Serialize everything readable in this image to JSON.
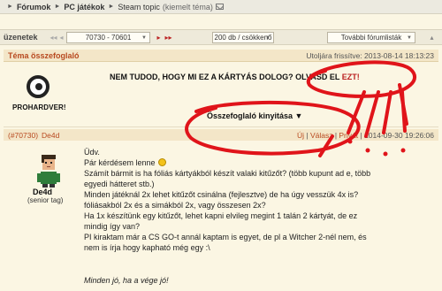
{
  "breadcrumb": {
    "items": [
      "Fórumok",
      "PC játékok",
      "Steam topic"
    ],
    "suffix": "(kiemelt téma)"
  },
  "navbar": {
    "label": "üzenetek",
    "range_select": "70730 - 70601",
    "count_select": "200 db / csökkenő",
    "more_select": "További fórumlisták"
  },
  "topic": {
    "title": "Téma összefoglaló",
    "updated": "Utoljára frissítve: 2013-08-14 18:13:23",
    "logo_text": "PROHARDVER!",
    "notice_text": "NEM TUDOD, HOGY MI EZ A KÁRTYÁS DOLOG? OLVASD EL",
    "notice_link": "EZT!",
    "expand_label": "Összefoglaló kinyitása ▼"
  },
  "post": {
    "number": "(#70730)",
    "user": "De4d",
    "actions": {
      "new": "Új",
      "reply": "Válasz",
      "private": "Privát",
      "timestamp": "2014-09-30 19:26:06"
    },
    "author_name": "De4d",
    "author_tag": "(senior tag)",
    "lines": [
      "Üdv.",
      "Pár kérdésem lenne",
      "Számít bármit is ha fóliás kártyákból készít valaki kitűzőt? (több kupunt ad e, több",
      "egyedi hátteret stb.)",
      "Minden játéknál 2x lehet kitűzőt csinálna (fejlesztve) de ha úgy vesszük 4x is?",
      "fóliásakból 2x és a simákból 2x, vagy összesen 2x?",
      "Ha 1x készítünk egy kitűzőt, lehet kapni elvileg megint 1 talán 2 kártyát, de ez",
      "mindig így van?",
      "PI kiraktam már a CS GO-t annál kaptam is egyet, de pl a Witcher 2-nél nem, és",
      "nem is írja hogy kapható még egy :\\"
    ],
    "signature": "Minden jó, ha a vége jó!"
  },
  "colors": {
    "accent": "#b8491f",
    "highlight_ink": "#e0141a",
    "header_bg": "#f3e6c8",
    "page_bg": "#fbf6e3"
  }
}
